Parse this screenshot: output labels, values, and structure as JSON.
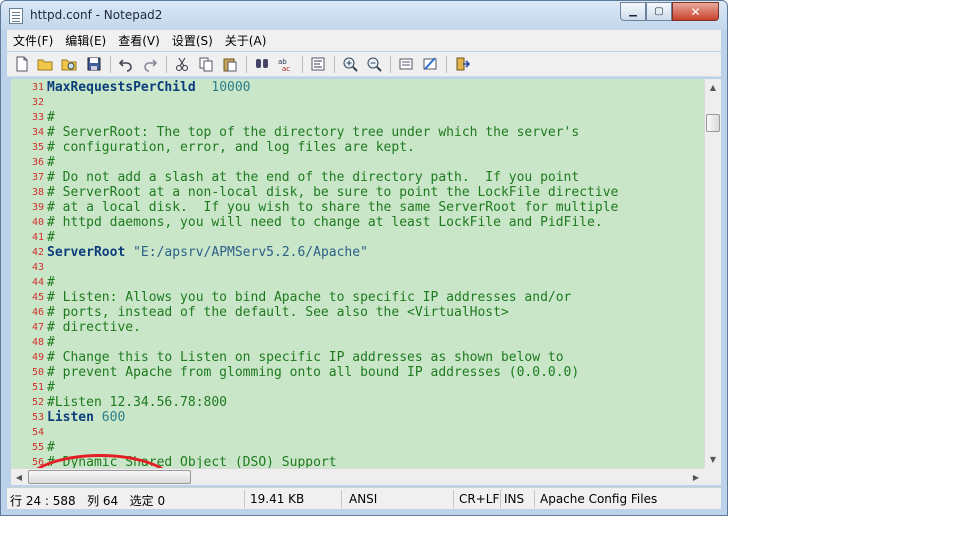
{
  "window": {
    "title": "httpd.conf - Notepad2",
    "controls": {
      "minimize": "▁",
      "maximize": "▢",
      "close": "✕"
    }
  },
  "menu": [
    {
      "label": "文件(F)"
    },
    {
      "label": "编辑(E)"
    },
    {
      "label": "查看(V)"
    },
    {
      "label": "设置(S)"
    },
    {
      "label": "关于(A)"
    }
  ],
  "toolbar": {
    "icons": [
      "new-file-icon",
      "open-folder-icon",
      "browse-icon",
      "save-icon",
      "undo-icon",
      "redo-icon",
      "cut-icon",
      "copy-icon",
      "paste-icon",
      "find-icon",
      "replace-icon",
      "word-wrap-icon",
      "zoom-in-icon",
      "zoom-out-icon",
      "scheme-icon",
      "customize-scheme-icon",
      "exit-icon"
    ]
  },
  "editor": {
    "lines": [
      {
        "n": "31",
        "kind": "directive",
        "key": "MaxRequestsPerChild",
        "val": "  10000"
      },
      {
        "n": "32",
        "kind": "blank",
        "text": ""
      },
      {
        "n": "33",
        "kind": "comment",
        "text": "#"
      },
      {
        "n": "34",
        "kind": "comment",
        "text": "# ServerRoot: The top of the directory tree under which the server's"
      },
      {
        "n": "35",
        "kind": "comment",
        "text": "# configuration, error, and log files are kept."
      },
      {
        "n": "36",
        "kind": "comment",
        "text": "#"
      },
      {
        "n": "37",
        "kind": "comment",
        "text": "# Do not add a slash at the end of the directory path.  If you point"
      },
      {
        "n": "38",
        "kind": "comment",
        "text": "# ServerRoot at a non-local disk, be sure to point the LockFile directive"
      },
      {
        "n": "39",
        "kind": "comment",
        "text": "# at a local disk.  If you wish to share the same ServerRoot for multiple"
      },
      {
        "n": "40",
        "kind": "comment",
        "text": "# httpd daemons, you will need to change at least LockFile and PidFile."
      },
      {
        "n": "41",
        "kind": "comment",
        "text": "#"
      },
      {
        "n": "42",
        "kind": "directive",
        "key": "ServerRoot",
        "val": " \"E:/apsrv/APMServ5.2.6/Apache\""
      },
      {
        "n": "43",
        "kind": "blank",
        "text": ""
      },
      {
        "n": "44",
        "kind": "comment",
        "text": "#"
      },
      {
        "n": "45",
        "kind": "comment",
        "text": "# Listen: Allows you to bind Apache to specific IP addresses and/or"
      },
      {
        "n": "46",
        "kind": "comment",
        "text": "# ports, instead of the default. See also the <VirtualHost>"
      },
      {
        "n": "47",
        "kind": "comment",
        "text": "# directive."
      },
      {
        "n": "48",
        "kind": "comment",
        "text": "#"
      },
      {
        "n": "49",
        "kind": "comment",
        "text": "# Change this to Listen on specific IP addresses as shown below to"
      },
      {
        "n": "50",
        "kind": "comment",
        "text": "# prevent Apache from glomming onto all bound IP addresses (0.0.0.0)"
      },
      {
        "n": "51",
        "kind": "comment",
        "text": "#"
      },
      {
        "n": "52",
        "kind": "comment",
        "text": "#Listen 12.34.56.78:800"
      },
      {
        "n": "53",
        "kind": "directive",
        "key": "Listen",
        "val": " 600"
      },
      {
        "n": "54",
        "kind": "blank",
        "text": ""
      },
      {
        "n": "55",
        "kind": "comment",
        "text": "#"
      },
      {
        "n": "56",
        "kind": "comment",
        "text": "# Dynamic Shared Object (DSO) Support"
      }
    ]
  },
  "scrollbars": {
    "up": "▲",
    "down": "▼",
    "left": "◀",
    "right": "▶"
  },
  "statusbar": {
    "position": "行 24 : 588   列 64   选定 0",
    "size": "19.41 KB",
    "encoding": "ANSI",
    "eol": "CR+LF",
    "mode": "INS",
    "scheme": "Apache Config Files"
  }
}
